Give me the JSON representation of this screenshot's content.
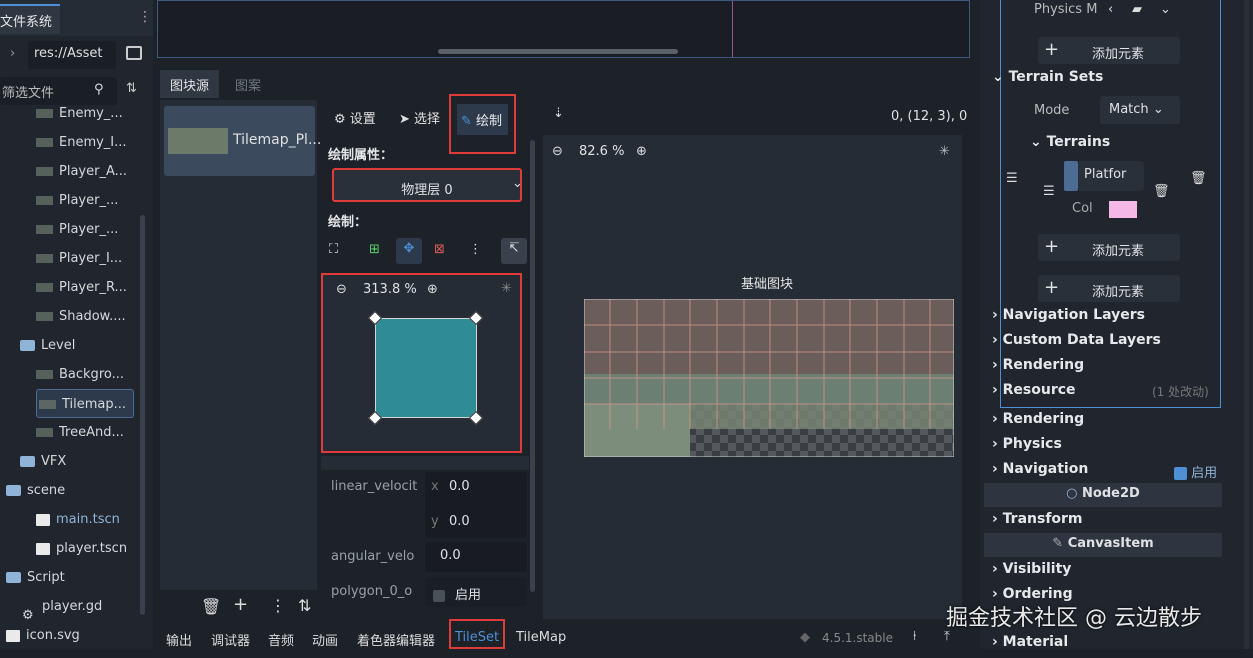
{
  "filesystem": {
    "tab_label": "文件系统",
    "path": "res://Asset",
    "filter_placeholder": "筛选文件",
    "items": [
      {
        "label": "Enemy_...",
        "kind": "tex"
      },
      {
        "label": "Enemy_I...",
        "kind": "tex"
      },
      {
        "label": "Player_A...",
        "kind": "tex"
      },
      {
        "label": "Player_...",
        "kind": "tex"
      },
      {
        "label": "Player_...",
        "kind": "tex"
      },
      {
        "label": "Player_I...",
        "kind": "tex"
      },
      {
        "label": "Player_R...",
        "kind": "tex"
      },
      {
        "label": "Shadow....",
        "kind": "tex"
      },
      {
        "label": "Level",
        "kind": "folder"
      },
      {
        "label": "Backgro...",
        "kind": "tex"
      },
      {
        "label": "Tilemap...",
        "kind": "tex"
      },
      {
        "label": "TreeAnd...",
        "kind": "tex"
      },
      {
        "label": "VFX",
        "kind": "folder"
      },
      {
        "label": "scene",
        "kind": "folder"
      },
      {
        "label": "main.tscn",
        "kind": "scene"
      },
      {
        "label": "player.tscn",
        "kind": "scene"
      },
      {
        "label": "Script",
        "kind": "folder"
      },
      {
        "label": "player.gd",
        "kind": "script"
      },
      {
        "label": "icon.svg",
        "kind": "svg"
      }
    ]
  },
  "tileset_panel": {
    "tabs": [
      "图块源",
      "图案"
    ],
    "source_item": "Tilemap_Pl...",
    "toolbar": {
      "settings": "设置",
      "select": "选择",
      "paint": "绘制"
    },
    "coords": "0, (12, 3), 0",
    "paint_props_label": "绘制属性：",
    "layer_dropdown": "物理层 0",
    "paint_label": "绘制：",
    "zoom_small": "313.8 %",
    "zoom_main": "82.6 %",
    "atlas_title": "基础图块",
    "props": [
      {
        "name": "linear_velocit",
        "x": "0.0",
        "y": "0.0"
      },
      {
        "name": "angular_velo",
        "value": "0.0"
      },
      {
        "name": "polygon_0_o",
        "check_label": "启用"
      }
    ]
  },
  "bottom_bar": {
    "tabs": [
      "输出",
      "调试器",
      "音频",
      "动画",
      "着色器编辑器",
      "TileSet",
      "TileMap"
    ],
    "version": "4.5.1.stable"
  },
  "inspector": {
    "physics_m_label": "Physics M",
    "add_element": "添加元素",
    "terrain_sets": "Terrain Sets",
    "mode_label": "Mode",
    "mode_value": "Match",
    "terrains": "Terrains",
    "terrain_name": "Platfor",
    "col_label": "Col",
    "sections": [
      "Navigation Layers",
      "Custom Data Layers",
      "Rendering",
      "Resource"
    ],
    "resource_note": "(1 处改动)",
    "node_sections": [
      "Rendering",
      "Physics",
      "Navigation"
    ],
    "nav_enabled": "启用",
    "node2d": "Node2D",
    "transform": "Transform",
    "canvasitem": "CanvasItem",
    "canvas_sections": [
      "Visibility",
      "Ordering",
      "Material"
    ]
  },
  "watermark": "掘金技术社区 @ 云边散步",
  "colors": {
    "accent": "#4e8fd6",
    "highlight": "#e03b3b",
    "terrain_color": "#f5b8e6",
    "polygon": "#2f8b96"
  }
}
